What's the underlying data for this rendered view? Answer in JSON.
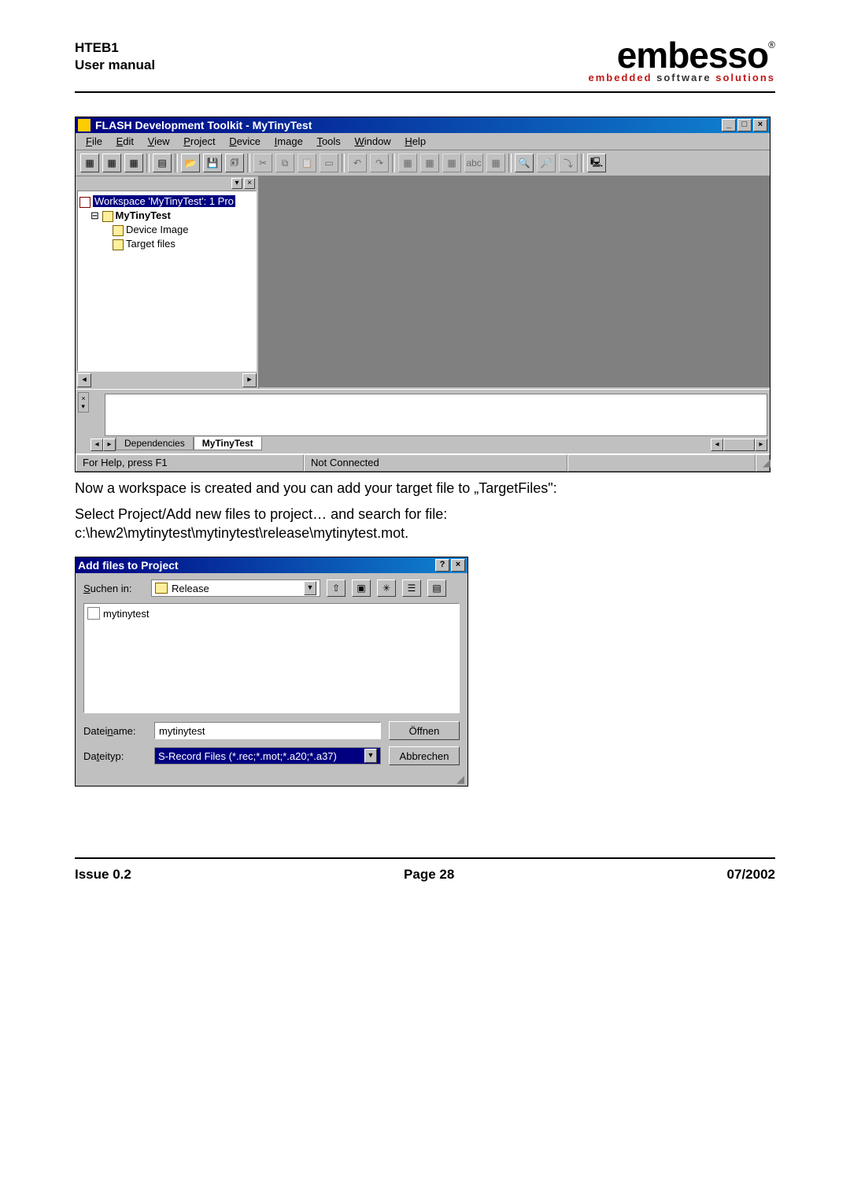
{
  "doc": {
    "header_l1": "HTEB1",
    "header_l2": "User manual",
    "logo_main": "embesso",
    "logo_tag1": "embedded ",
    "logo_tag2": "software ",
    "logo_tag3": "solutions"
  },
  "app": {
    "title": "FLASH Development Toolkit - MyTinyTest",
    "winbtns": {
      "min": "_",
      "max": "□",
      "close": "×"
    },
    "menu": [
      "File",
      "Edit",
      "View",
      "Project",
      "Device",
      "Image",
      "Tools",
      "Window",
      "Help"
    ],
    "menu_hot": [
      "F",
      "E",
      "V",
      "P",
      "D",
      "I",
      "T",
      "W",
      "H"
    ],
    "panebtns": [
      "▾",
      "×"
    ],
    "tree": {
      "root": "Workspace 'MyTinyTest': 1 Pro",
      "project": "MyTinyTest",
      "c1": "Device Image",
      "c2": "Target files"
    },
    "tabs": {
      "dep": "Dependencies",
      "prj": "MyTinyTest"
    },
    "status": {
      "help": "For Help, press F1",
      "conn": "Not Connected"
    },
    "tb_abc": "abc"
  },
  "text": {
    "p1": "Now a workspace is created and you can add your target file to „TargetFiles\":",
    "p2": "Select Project/Add new files to project… and search for file: c:\\hew2\\mytinytest\\mytinytest\\release\\mytinytest.mot."
  },
  "dlg": {
    "title": "Add files to Project",
    "help": "?",
    "close": "×",
    "lookin_lbl": "Suchen in:",
    "lookin_val": "Release",
    "file_item": "mytinytest",
    "fname_lbl": "Dateiname:",
    "fname_val": "mytinytest",
    "ftype_lbl": "Dateityp:",
    "ftype_val": "S-Record Files (*.rec;*.mot;*.a20;*.a37)",
    "open": "Öffnen",
    "cancel": "Abbrechen"
  },
  "footer": {
    "l": "Issue 0.2",
    "c": "Page 28",
    "r": "07/2002"
  }
}
